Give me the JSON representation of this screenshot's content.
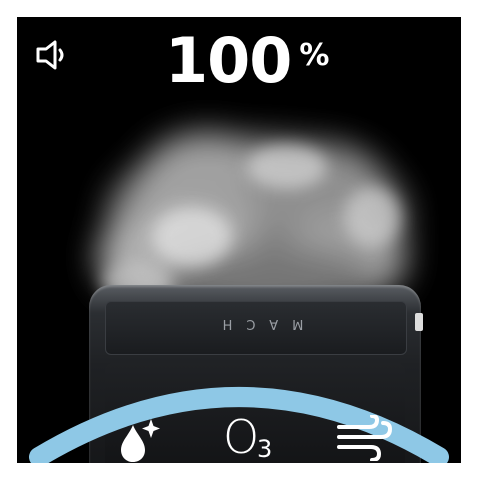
{
  "status": {
    "volume_icon": "speaker-icon",
    "level_value": "100",
    "level_unit": "%"
  },
  "device": {
    "brand_label": "MACH"
  },
  "modes": {
    "items": [
      {
        "icon": "mist-drop-sparkle-icon"
      },
      {
        "icon": "ozone-o3-icon",
        "label": "O",
        "subscript": "3"
      },
      {
        "icon": "fan-wind-icon"
      }
    ],
    "arc_color": "#8ec8e6"
  }
}
